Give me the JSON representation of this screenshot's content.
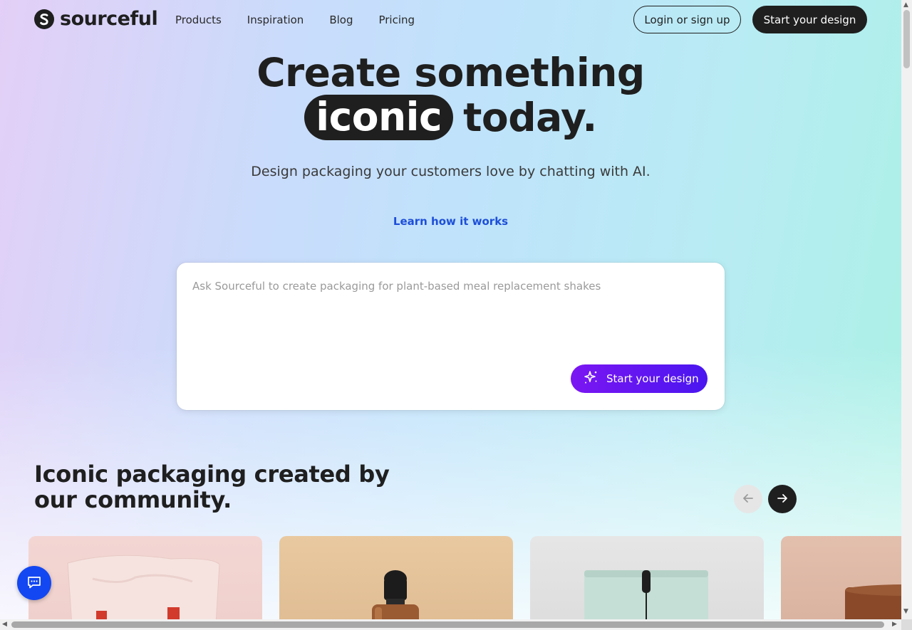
{
  "brand": {
    "name": "sourceful",
    "logo_icon": "sourceful-s-logo"
  },
  "nav": {
    "items": [
      {
        "label": "Products"
      },
      {
        "label": "Inspiration"
      },
      {
        "label": "Blog"
      },
      {
        "label": "Pricing"
      }
    ]
  },
  "header": {
    "login_label": "Login or sign up",
    "start_label": "Start your design"
  },
  "hero": {
    "title_line1": "Create something",
    "title_highlight": "iconic",
    "title_line2_rest": "today.",
    "subtitle": "Design packaging your customers love by chatting with AI.",
    "learn_link": "Learn how it works"
  },
  "prompt": {
    "placeholder": "Ask Sourceful to create packaging for plant-based meal replacement shakes",
    "value": "",
    "button_label": "Start your design",
    "button_icon": "sparkle-icon"
  },
  "community": {
    "title": "Iconic packaging created by our community.",
    "prev_icon": "arrow-left-icon",
    "next_icon": "arrow-right-icon",
    "cards": [
      {
        "subject": "pink pouch packaging"
      },
      {
        "subject": "dropper bottle"
      },
      {
        "subject": "mint stand-up pouch"
      },
      {
        "subject": "brown cylinder tube"
      }
    ]
  },
  "chat": {
    "icon": "chat-bubble-icon"
  },
  "colors": {
    "primary_dark": "#1f1f1f",
    "accent_purple": "#7b16f2",
    "accent_blue": "#1347f2",
    "link_blue": "#1d4fd8"
  }
}
